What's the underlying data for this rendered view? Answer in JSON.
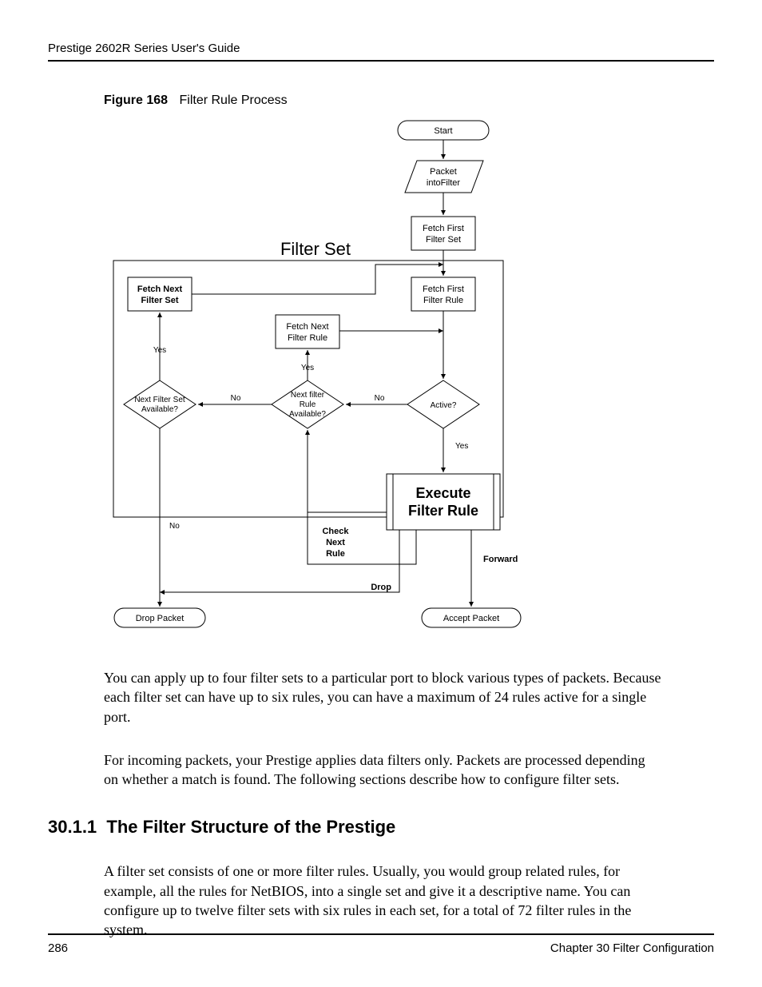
{
  "header": {
    "text": "Prestige 2602R Series User's Guide"
  },
  "figure": {
    "label": "Figure 168",
    "caption": "Filter Rule Process",
    "section_title": "Filter Set",
    "nodes": {
      "start": "Start",
      "packet_into_filter_l1": "Packet",
      "packet_into_filter_l2": "intoFilter",
      "fetch_first_set_l1": "Fetch First",
      "fetch_first_set_l2": "Filter Set",
      "fetch_first_rule_l1": "Fetch First",
      "fetch_first_rule_l2": "Filter Rule",
      "fetch_next_set_l1": "Fetch Next",
      "fetch_next_set_l2": "Filter Set",
      "fetch_next_rule_l1": "Fetch Next",
      "fetch_next_rule_l2": "Filter Rule",
      "active": "Active?",
      "next_rule_avail_l1": "Next filter",
      "next_rule_avail_l2": "Rule",
      "next_rule_avail_l3": "Available?",
      "next_set_avail_l1": "Next Filter Set",
      "next_set_avail_l2": "Available?",
      "exec_l1": "Execute",
      "exec_l2": "Filter Rule",
      "check_next_l1": "Check",
      "check_next_l2": "Next",
      "check_next_l3": "Rule",
      "drop_packet": "Drop Packet",
      "accept_packet": "Accept Packet"
    },
    "edge_labels": {
      "yes": "Yes",
      "no": "No",
      "drop": "Drop",
      "forward": "Forward"
    }
  },
  "paragraphs": {
    "p1": "You can apply up to four filter sets to a particular port to block various types of packets. Because each filter set can have up to six rules, you can have a maximum of 24 rules active for a single port.",
    "p2": "For incoming packets, your Prestige applies data filters only. Packets are processed depending on whether a match is found. The following sections describe how to configure filter sets."
  },
  "subsection": {
    "number": "30.1.1",
    "title": "The Filter Structure of the Prestige",
    "body": "A filter set consists of one or more filter rules. Usually, you would group related rules, for example, all the rules for NetBIOS, into a single set and give it a descriptive name. You can configure up to twelve filter sets with six rules in each set, for a total of 72 filter rules in the system."
  },
  "footer": {
    "page": "286",
    "chapter": "Chapter 30 Filter Configuration"
  }
}
